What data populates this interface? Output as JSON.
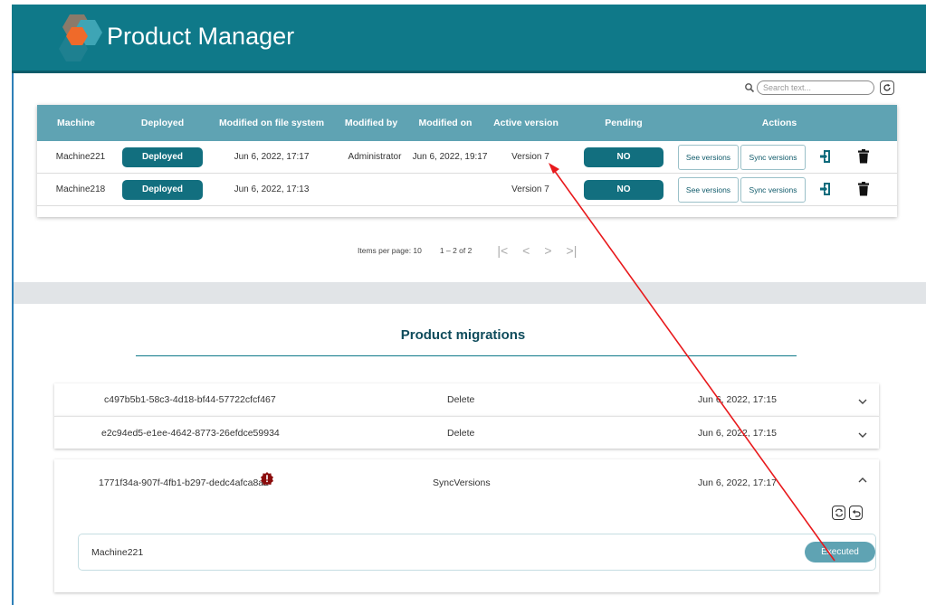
{
  "app": {
    "title": "Product Manager"
  },
  "search": {
    "placeholder": "Search text..."
  },
  "table": {
    "columns": [
      "Machine",
      "Deployed",
      "Modified on file system",
      "Modified by",
      "Modified on",
      "Active version",
      "Pending",
      "Actions"
    ],
    "rows": [
      {
        "machine": "Machine221",
        "deployed": "Deployed",
        "modified_fs": "Jun 6, 2022, 17:17",
        "modified_by": "Administrator",
        "modified_on": "Jun 6, 2022, 19:17",
        "active_version": "Version 7",
        "pending": "NO",
        "see_versions": "See versions",
        "sync_versions": "Sync versions"
      },
      {
        "machine": "Machine218",
        "deployed": "Deployed",
        "modified_fs": "Jun 6, 2022, 17:13",
        "modified_by": "",
        "modified_on": "",
        "active_version": "Version 7",
        "pending": "NO",
        "see_versions": "See versions",
        "sync_versions": "Sync versions"
      }
    ]
  },
  "paginator": {
    "items_per_page_label": "Items per page: 10",
    "range_label": "1 – 2 of 2"
  },
  "migrations": {
    "title": "Product migrations",
    "items": [
      {
        "id": "c497b5b1-58c3-4d18-bf44-57722cfcf467",
        "action": "Delete",
        "date": "Jun 6, 2022, 17:15",
        "expanded": false
      },
      {
        "id": "e2c94ed5-e1ee-4642-8773-26efdce59934",
        "action": "Delete",
        "date": "Jun 6, 2022, 17:15",
        "expanded": false
      },
      {
        "id": "1771f34a-907f-4fb1-b297-dedc4afca8a2",
        "action": "SyncVersions",
        "date": "Jun 6, 2022, 17:17",
        "expanded": true,
        "has_error": true
      }
    ],
    "expanded_detail": {
      "machine": "Machine221",
      "status": "Executed"
    }
  },
  "colors": {
    "header": "#0f7989",
    "table_header": "#5fa3b3",
    "badge": "#126f7f",
    "annotation_arrow": "#e8191c"
  }
}
